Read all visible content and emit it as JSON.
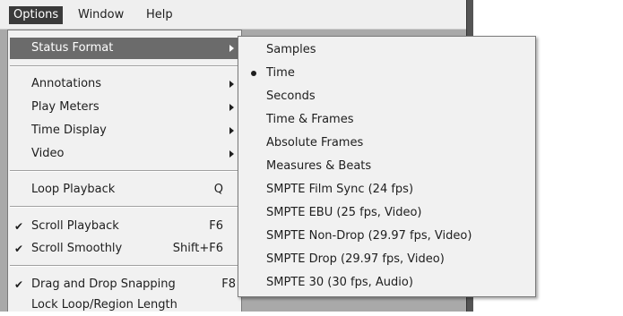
{
  "menubar": {
    "items": [
      {
        "label": "Options",
        "active": true
      },
      {
        "label": "Window",
        "active": false
      },
      {
        "label": "Help",
        "active": false
      }
    ]
  },
  "options_menu": {
    "items": [
      {
        "label": "Status Format",
        "shortcut": "",
        "checked": false,
        "submenu": true,
        "selected": true
      },
      {
        "label": "Annotations",
        "shortcut": "",
        "checked": false,
        "submenu": true
      },
      {
        "label": "Play Meters",
        "shortcut": "",
        "checked": false,
        "submenu": true
      },
      {
        "label": "Time Display",
        "shortcut": "",
        "checked": false,
        "submenu": true
      },
      {
        "label": "Video",
        "shortcut": "",
        "checked": false,
        "submenu": true
      },
      {
        "label": "Loop Playback",
        "shortcut": "Q",
        "checked": false,
        "submenu": false
      },
      {
        "label": "Scroll Playback",
        "shortcut": "F6",
        "checked": true,
        "submenu": false
      },
      {
        "label": "Scroll Smoothly",
        "shortcut": "Shift+F6",
        "checked": true,
        "submenu": false
      },
      {
        "label": "Drag and Drop Snapping",
        "shortcut": "F8",
        "checked": true,
        "submenu": false
      },
      {
        "label": "Lock Loop/Region Length",
        "shortcut": "",
        "checked": false,
        "submenu": false
      }
    ],
    "check_glyph": "✔"
  },
  "status_format_submenu": {
    "items": [
      {
        "label": "Samples",
        "selected": false
      },
      {
        "label": "Time",
        "selected": true
      },
      {
        "label": "Seconds",
        "selected": false
      },
      {
        "label": "Time & Frames",
        "selected": false
      },
      {
        "label": "Absolute Frames",
        "selected": false
      },
      {
        "label": "Measures & Beats",
        "selected": false
      },
      {
        "label": "SMPTE Film Sync (24 fps)",
        "selected": false
      },
      {
        "label": "SMPTE EBU (25 fps, Video)",
        "selected": false
      },
      {
        "label": "SMPTE Non-Drop (29.97 fps, Video)",
        "selected": false
      },
      {
        "label": "SMPTE Drop (29.97 fps, Video)",
        "selected": false
      },
      {
        "label": "SMPTE 30 (30 fps, Audio)",
        "selected": false
      }
    ]
  },
  "colors": {
    "menu_background": "#f1f1f1",
    "selection": "#6b6b6b",
    "menubar_active": "#3a3a3a"
  }
}
